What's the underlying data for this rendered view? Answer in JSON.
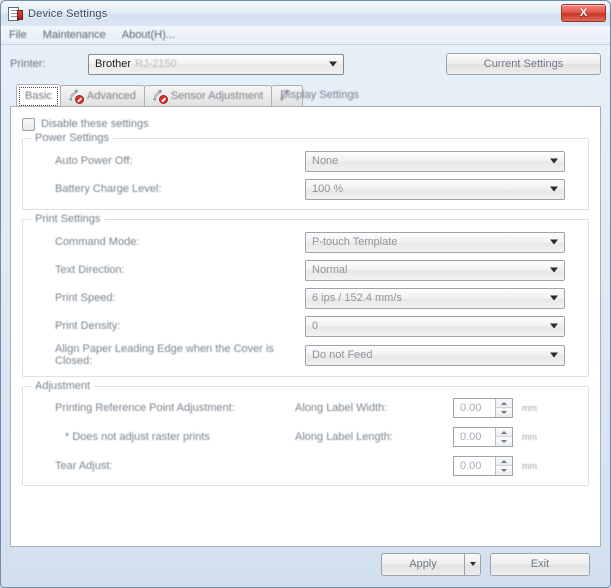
{
  "window": {
    "title": "Device Settings",
    "icon": "printer-label-icon",
    "close_label": "X"
  },
  "menubar": {
    "items": [
      {
        "label": "File"
      },
      {
        "label": "Maintenance"
      },
      {
        "label": "About(H)..."
      }
    ]
  },
  "printer_row": {
    "label": "Printer:",
    "brand": "Brother",
    "model": "RJ-2150",
    "current_settings_label": "Current Settings"
  },
  "tabs": [
    {
      "label": "Basic",
      "icon": "none",
      "active": true
    },
    {
      "label": "Advanced",
      "icon": "wrench-blocked-icon",
      "active": false
    },
    {
      "label": "Sensor Adjustment",
      "icon": "wrench-blocked-icon",
      "active": false
    },
    {
      "label": "Display Settings",
      "icon": "wrench-blocked-icon",
      "active": false
    }
  ],
  "panel": {
    "disable_checkbox": {
      "label": "Disable these settings",
      "checked": false
    },
    "power_settings": {
      "title": "Power Settings",
      "fields": [
        {
          "label": "Auto Power Off:",
          "value": "None"
        },
        {
          "label": "Battery Charge Level:",
          "value": "100 %"
        }
      ]
    },
    "print_settings": {
      "title": "Print Settings",
      "fields": [
        {
          "label": "Command Mode:",
          "value": "P-touch Template"
        },
        {
          "label": "Text Direction:",
          "value": "Normal"
        },
        {
          "label": "Print Speed:",
          "value": "6 ips / 152.4 mm/s"
        },
        {
          "label": "Print Density:",
          "value": "0"
        },
        {
          "label": "Align Paper Leading Edge when the Cover is Closed:",
          "value": "Do not Feed"
        }
      ]
    },
    "adjustment": {
      "title": "Adjustment",
      "rows": [
        {
          "left": "Printing Reference Point Adjustment:",
          "mid": "Along Label Width:",
          "value": "0.00",
          "unit": "mm"
        },
        {
          "left": "* Does not adjust raster prints",
          "mid": "Along Label Length:",
          "value": "0.00",
          "unit": "mm"
        },
        {
          "left": "Tear Adjust:",
          "mid": "",
          "value": "0.00",
          "unit": "mm"
        }
      ]
    }
  },
  "footer": {
    "apply_label": "Apply",
    "exit_label": "Exit"
  }
}
